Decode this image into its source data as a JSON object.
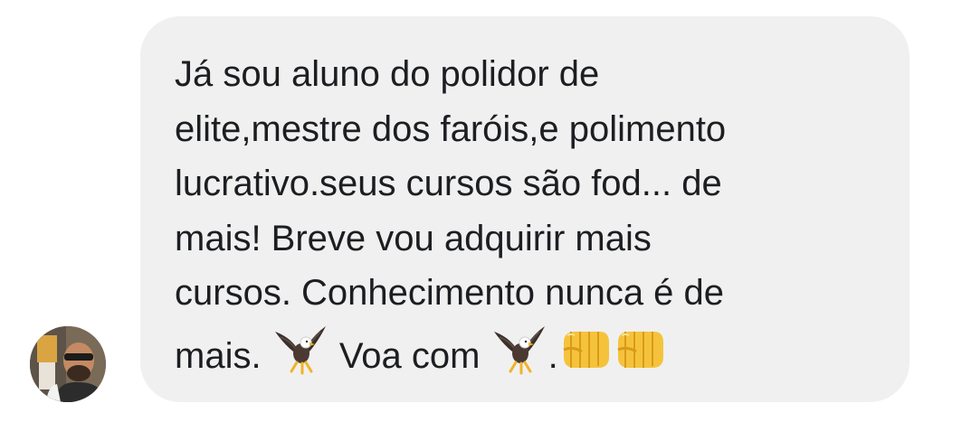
{
  "message": {
    "lines": [
      "Já sou aluno do polidor de",
      "elite,mestre dos faróis,e polimento",
      "lucrativo.seus cursos são fod... de",
      "mais! Breve vou adquirir mais",
      "cursos. Conhecimento nunca é de"
    ],
    "last_line": {
      "text_before": "mais.",
      "text_middle": "Voa com",
      "text_after": "."
    },
    "emojis": [
      "eagle-icon",
      "eagle-icon",
      "oncoming-fist-icon",
      "oncoming-fist-icon"
    ]
  },
  "colors": {
    "bubble": "#f0f0f0",
    "text": "#1c1e21",
    "fist": "#f5c33b"
  }
}
